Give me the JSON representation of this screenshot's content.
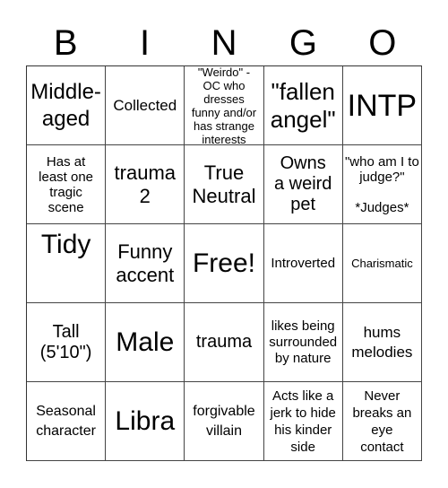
{
  "header": [
    "B",
    "I",
    "N",
    "G",
    "O"
  ],
  "cells": [
    [
      "Middle-\naged",
      "Collected",
      "\"Weirdo\" - OC who dresses funny and/or has strange interests",
      "\"fallen\nangel\"",
      "INTP"
    ],
    [
      "Has at least one tragic scene",
      "trauma\n2",
      "True\nNeutral",
      "Owns\na weird\npet",
      "\"who am I to judge?\"\n\n*Judges*"
    ],
    [
      "Tidy",
      "Funny\naccent",
      "Free!",
      "Introverted",
      "Charismatic"
    ],
    [
      "Tall\n(5'10\")",
      "Male",
      "trauma",
      "likes being surrounded by nature",
      "hums\nmelodies"
    ],
    [
      "Seasonal character",
      "Libra",
      "forgivable villain",
      "Acts like a jerk to hide his kinder side",
      "Never breaks an eye contact"
    ]
  ]
}
